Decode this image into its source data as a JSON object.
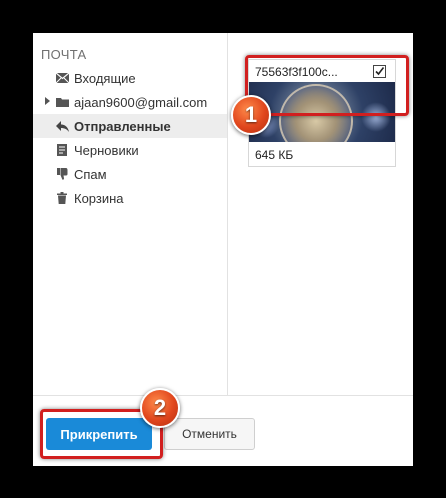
{
  "sidebar": {
    "heading": "ПОЧТА",
    "items": [
      {
        "label": "Входящие",
        "icon": "envelope-icon"
      },
      {
        "label": "ajaan9600@gmail.com",
        "icon": "folder-icon"
      },
      {
        "label": "Отправленные",
        "icon": "reply-icon",
        "active": true
      },
      {
        "label": "Черновики",
        "icon": "draft-icon"
      },
      {
        "label": "Спам",
        "icon": "thumbs-down-icon"
      },
      {
        "label": "Корзина",
        "icon": "trash-icon"
      }
    ]
  },
  "attachment": {
    "name": "75563f3f100c...",
    "size": "645 КБ",
    "checked": true
  },
  "footer": {
    "attach_label": "Прикрепить",
    "cancel_label": "Отменить"
  },
  "annotations": {
    "step1": "1",
    "step2": "2"
  },
  "colors": {
    "primary_button": "#1a8ad8",
    "highlight": "#d11f1f",
    "badge": "#e0461d"
  }
}
